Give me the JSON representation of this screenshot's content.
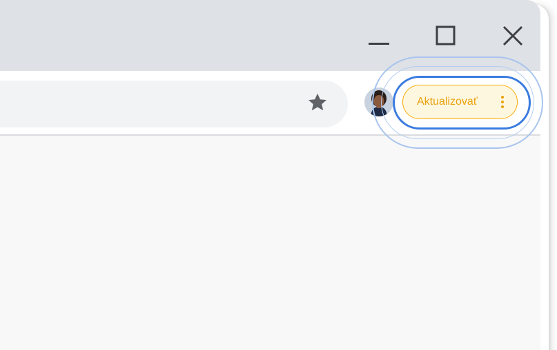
{
  "window_controls": {
    "minimize_icon": "minimize-icon",
    "maximize_icon": "maximize-icon",
    "close_icon": "close-icon"
  },
  "toolbar": {
    "bookmark_icon": "star-icon",
    "profile_icon": "avatar",
    "update_button": {
      "label": "Aktualizovať",
      "menu_icon": "three-dots-vertical-icon",
      "accent_color": "#f9ab00",
      "background_color": "#fef7e0",
      "text_color": "#e8a10a"
    },
    "focus_ring_color": "#3a7be0"
  },
  "colors": {
    "titlebar": "#dee1e6",
    "toolbar": "#ffffff",
    "omnibox": "#f1f3f4",
    "content": "#f8f8f8"
  }
}
